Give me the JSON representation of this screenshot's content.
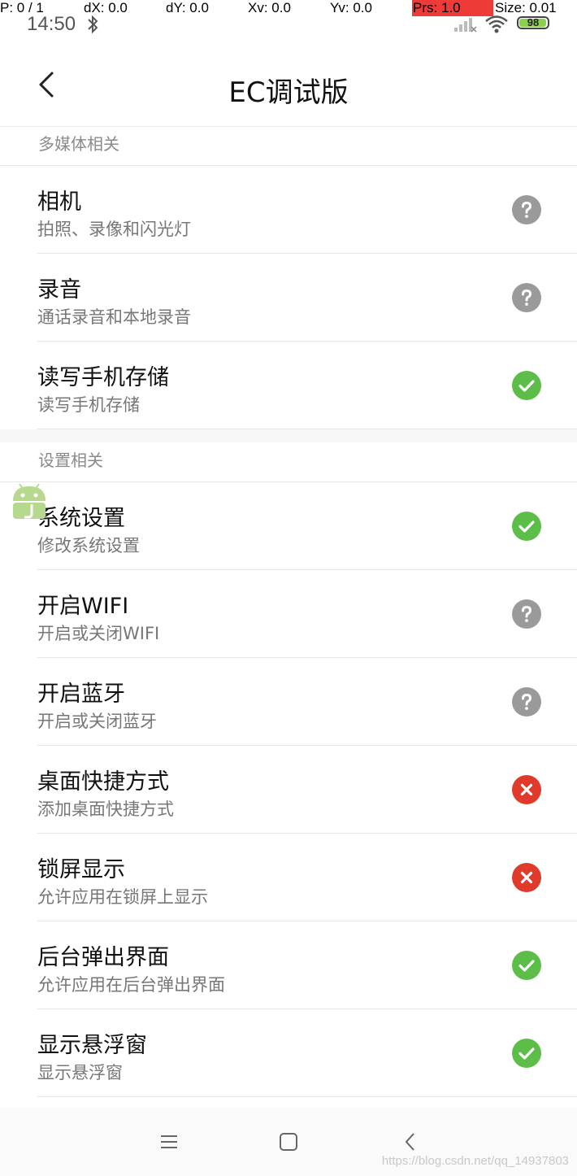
{
  "debug": {
    "pointer": "P: 0 / 1",
    "dx": "dX: 0.0",
    "dy": "dY: 0.0",
    "xv": "Xv: 0.0",
    "yv": "Yv: 0.0",
    "prs": "Prs: 1.0",
    "size": "Size: 0.01"
  },
  "status_bar": {
    "time": "14:50",
    "battery": "98",
    "battery_level_percent": 98
  },
  "header": {
    "title": "EC调试版"
  },
  "sections": [
    {
      "label": "多媒体相关",
      "items": [
        {
          "title": "相机",
          "subtitle": "拍照、录像和闪光灯",
          "status": "unknown"
        },
        {
          "title": "录音",
          "subtitle": "通话录音和本地录音",
          "status": "unknown"
        },
        {
          "title": "读写手机存储",
          "subtitle": "读写手机存储",
          "status": "granted"
        }
      ]
    },
    {
      "label": "设置相关",
      "items": [
        {
          "title": "系统设置",
          "subtitle": "修改系统设置",
          "status": "granted"
        },
        {
          "title": "开启WIFI",
          "subtitle": "开启或关闭WIFI",
          "status": "unknown"
        },
        {
          "title": "开启蓝牙",
          "subtitle": "开启或关闭蓝牙",
          "status": "unknown"
        },
        {
          "title": "桌面快捷方式",
          "subtitle": "添加桌面快捷方式",
          "status": "denied"
        },
        {
          "title": "锁屏显示",
          "subtitle": "允许应用在锁屏上显示",
          "status": "denied"
        },
        {
          "title": "后台弹出界面",
          "subtitle": "允许应用在后台弹出界面",
          "status": "granted"
        },
        {
          "title": "显示悬浮窗",
          "subtitle": "显示悬浮窗",
          "status": "granted"
        }
      ]
    }
  ],
  "status_colors": {
    "granted": "#5cbd48",
    "denied": "#e03a2b",
    "unknown": "#9a9a9a"
  },
  "status_icons": {
    "granted": "check-circle-icon",
    "denied": "x-circle-icon",
    "unknown": "question-circle-icon"
  },
  "nav_bar": {
    "menu_icon": "menu-icon",
    "home_icon": "home-square-icon",
    "back_icon": "back-chevron-icon"
  },
  "watermark": "https://blog.csdn.net/qq_14937803"
}
